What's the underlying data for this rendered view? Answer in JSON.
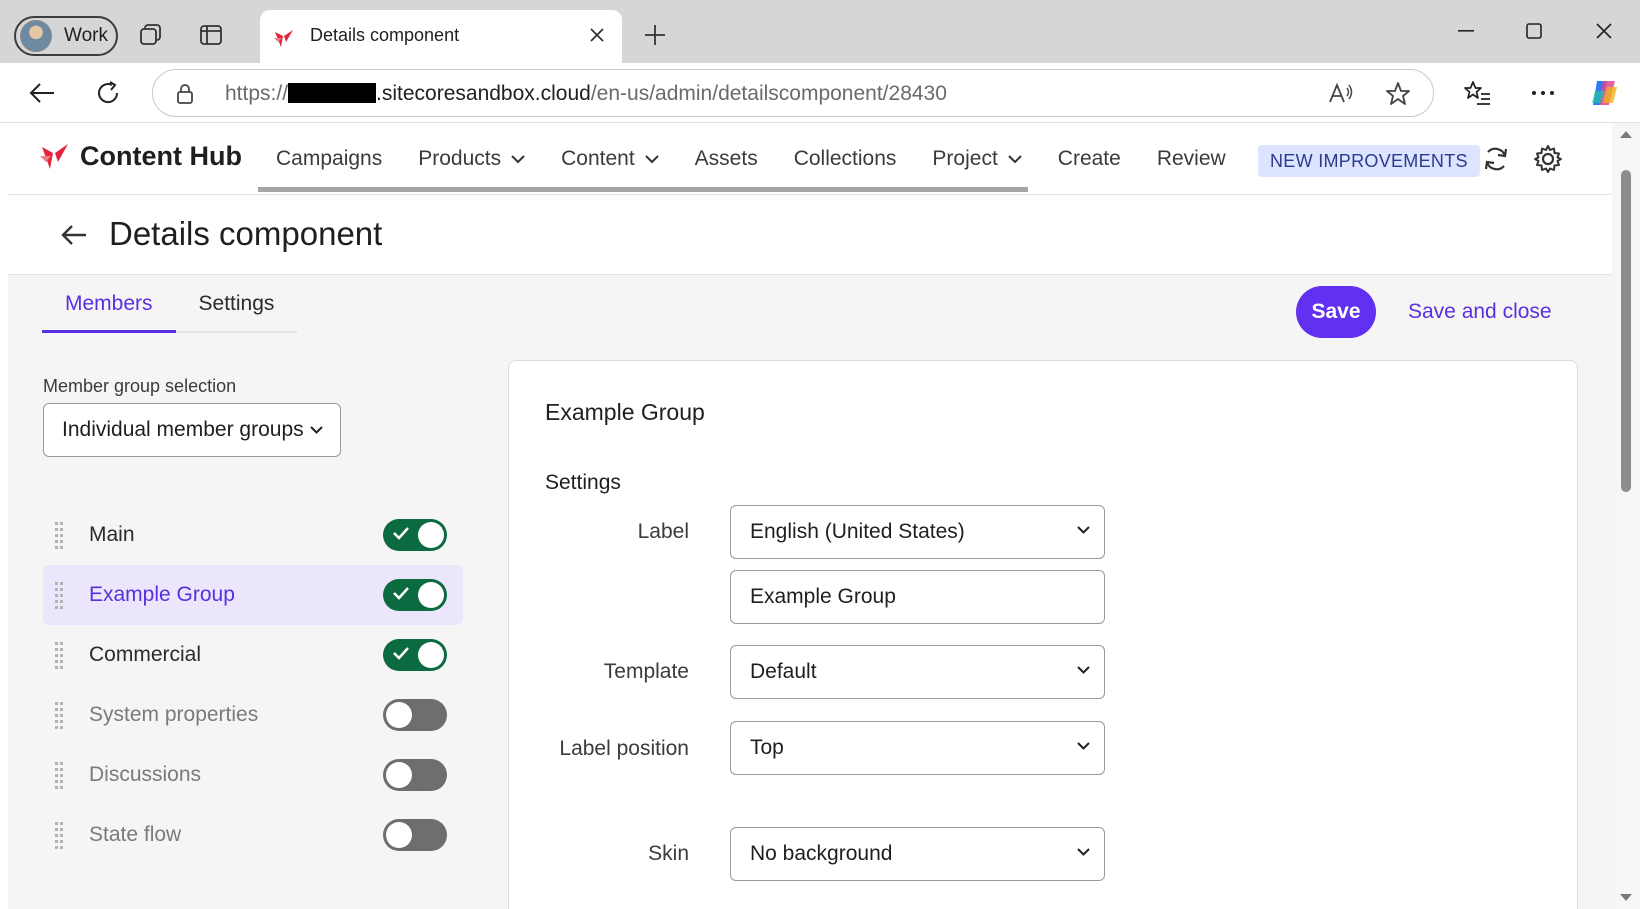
{
  "browser": {
    "profile_label": "Work",
    "tab_title": "Details component",
    "url_prefix": "https://",
    "url_domain": ".sitecoresandbox.cloud",
    "url_path": "/en-us/admin/detailscomponent/28430"
  },
  "app": {
    "brand": "Content Hub",
    "brand_color": "#e2253d",
    "accent_color": "#6130f0",
    "nav": [
      "Campaigns",
      "Products",
      "Content",
      "Assets",
      "Collections",
      "Project",
      "Create",
      "Review"
    ],
    "badge": "NEW IMPROVEMENTS"
  },
  "page": {
    "title": "Details component",
    "tabs": [
      "Members",
      "Settings"
    ],
    "active_tab": "Members",
    "save": "Save",
    "save_close": "Save and close"
  },
  "member_groups": {
    "label": "Member group selection",
    "value": "Individual member groups",
    "items": [
      {
        "name": "Main",
        "enabled": true
      },
      {
        "name": "Example Group",
        "enabled": true
      },
      {
        "name": "Commercial",
        "enabled": true
      },
      {
        "name": "System properties",
        "enabled": false
      },
      {
        "name": "Discussions",
        "enabled": false
      },
      {
        "name": "State flow",
        "enabled": false
      }
    ]
  },
  "details": {
    "title": "Example Group",
    "section": "Settings",
    "label_field": "Label",
    "label_language": "English (United States)",
    "label_value": "Example Group",
    "template_field": "Template",
    "template_value": "Default",
    "label_position_field": "Label position",
    "label_position_value": "Top",
    "skin_field": "Skin",
    "skin_value": "No background"
  }
}
